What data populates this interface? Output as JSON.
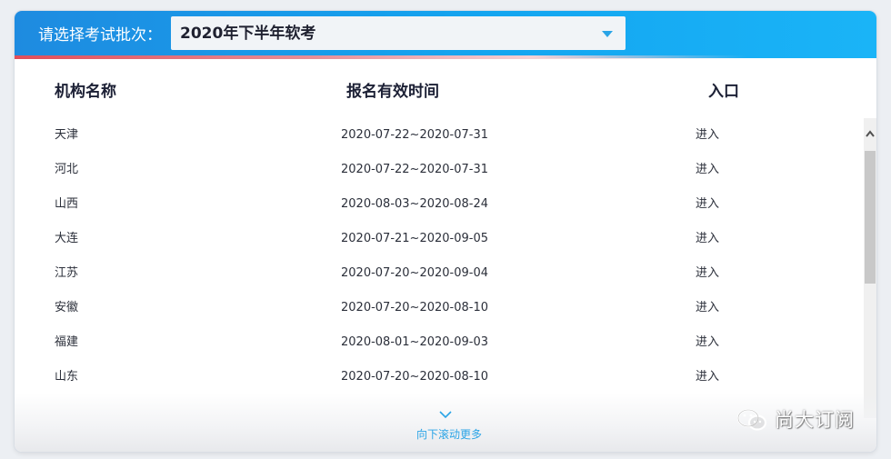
{
  "header": {
    "batch_label": "请选择考试批次：",
    "selected_batch": "2020年下半年软考"
  },
  "table": {
    "columns": [
      "机构名称",
      "报名有效时间",
      "入口"
    ],
    "rows": [
      {
        "name": "天津",
        "period": "2020-07-22~2020-07-31",
        "entry": "进入"
      },
      {
        "name": "河北",
        "period": "2020-07-22~2020-07-31",
        "entry": "进入"
      },
      {
        "name": "山西",
        "period": "2020-08-03~2020-08-24",
        "entry": "进入"
      },
      {
        "name": "大连",
        "period": "2020-07-21~2020-09-05",
        "entry": "进入"
      },
      {
        "name": "江苏",
        "period": "2020-07-20~2020-09-04",
        "entry": "进入"
      },
      {
        "name": "安徽",
        "period": "2020-07-20~2020-08-10",
        "entry": "进入"
      },
      {
        "name": "福建",
        "period": "2020-08-01~2020-09-03",
        "entry": "进入"
      },
      {
        "name": "山东",
        "period": "2020-07-20~2020-08-10",
        "entry": "进入"
      }
    ]
  },
  "footer": {
    "scroll_more": "向下滚动更多"
  },
  "watermark": {
    "text": "尚大订阅",
    "icon": "wechat-icon"
  },
  "colors": {
    "header_blue": "#14a5f0",
    "accent_red": "#e04e5a",
    "link_blue": "#2aa4e6"
  }
}
